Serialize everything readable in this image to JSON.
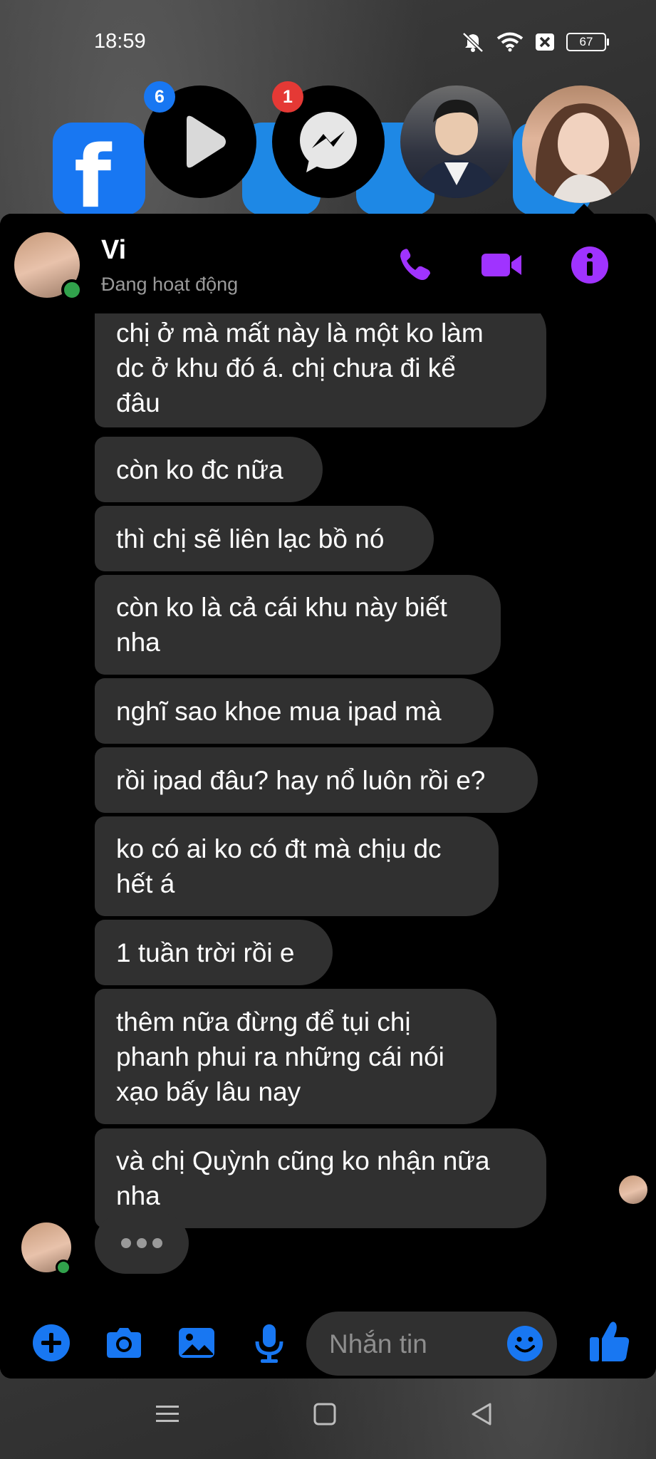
{
  "status_bar": {
    "time": "18:59",
    "battery": "67"
  },
  "chat_heads": {
    "video_badge": "6",
    "messenger_badge": "1"
  },
  "header": {
    "name": "Vi",
    "status": "Đang hoạt động"
  },
  "messages": [
    {
      "lines": [
        "chị ở mà mất này là một ko làm",
        "dc ở khu đó á. chị chưa đi kể",
        "đâu"
      ]
    },
    {
      "lines": [
        "còn ko đc nữa"
      ]
    },
    {
      "lines": [
        "thì chị sẽ liên lạc bồ nó"
      ]
    },
    {
      "lines": [
        "còn ko là cả cái khu này biết",
        "nha"
      ]
    },
    {
      "lines": [
        "nghĩ sao khoe mua ipad mà"
      ]
    },
    {
      "lines": [
        "rồi ipad đâu? hay nổ luôn rồi e?"
      ]
    },
    {
      "lines": [
        "ko có ai ko có đt mà chịu dc",
        "hết á"
      ]
    },
    {
      "lines": [
        "1 tuần trời rồi e"
      ]
    },
    {
      "lines": [
        "thêm nữa đừng để tụi chị",
        "phanh phui ra những cái nói",
        "xạo bấy lâu nay"
      ]
    },
    {
      "lines": [
        "và chị Quỳnh cũng ko nhận nữa",
        "nha"
      ]
    }
  ],
  "composer": {
    "placeholder": "Nhắn tin"
  },
  "colors": {
    "accent_purple": "#a033ff",
    "accent_blue": "#1877f2",
    "bubble": "#303030",
    "online": "#31a24c"
  },
  "icons": [
    "phone-icon",
    "video-call-icon",
    "info-icon",
    "plus-icon",
    "camera-icon",
    "gallery-icon",
    "microphone-icon",
    "emoji-icon",
    "like-icon",
    "recent-apps-icon",
    "home-icon",
    "back-icon"
  ]
}
